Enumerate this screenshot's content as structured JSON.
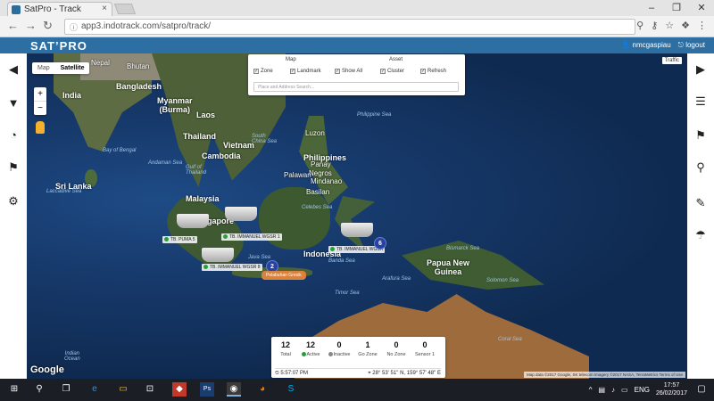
{
  "browser": {
    "tab_title": "SatPro - Track",
    "tab_close": "×",
    "url": "app3.indotrack.com/satpro/track/",
    "window_controls": [
      "–",
      "❐",
      "✕"
    ]
  },
  "app": {
    "logo": "SAT’PRO",
    "user": "nmcgaspiau",
    "logout": "logout"
  },
  "map": {
    "type_options": [
      "Map",
      "Satellite"
    ],
    "active_type": "Satellite",
    "traffic_label": "Traffic",
    "zoom_in": "+",
    "zoom_out": "−",
    "google": "Google",
    "attribution": "Map data ©2017 Google, SK telecom Imagery ©2017 NASA, TerraMetrics   Terms of Use",
    "labels": {
      "nepal": "Nepal",
      "bhutan": "Bhutan",
      "bangladesh": "Bangladesh",
      "india": "India",
      "myanmar": "Myanmar\n(Burma)",
      "laos": "Laos",
      "thailand": "Thailand",
      "vietnam": "Vietnam",
      "cambodia": "Cambodia",
      "philippines": "Philippines",
      "srilanka": "Sri Lanka",
      "malaysia": "Malaysia",
      "singapore": "Singapore",
      "indonesia": "Indonesia",
      "papua": "Papua New\nGuinea",
      "luzon": "Luzon",
      "panay": "Panay",
      "negros": "Negros",
      "mindanao": "Mindanao",
      "palawan": "Palawan",
      "basilan": "Basilan",
      "bay_bengal": "Bay of Bengal",
      "andaman": "Andaman Sea",
      "south_china": "South\nChina Sea",
      "gulf_thailand": "Gulf of\nThailand",
      "philippine_sea": "Philippine Sea",
      "celebes": "Celebes Sea",
      "laccadive": "Laccadive Sea",
      "java": "Java Sea",
      "banda": "Banda Sea",
      "arafura": "Arafura Sea",
      "timor": "Timor Sea",
      "coral": "Coral Sea",
      "solomon": "Solomon Sea",
      "bismarck": "Bismarck Sea",
      "indian_ocean": "Indian\nOcean"
    }
  },
  "filter": {
    "map_heading": "Map",
    "asset_heading": "Asset",
    "options": [
      {
        "label": "Zone",
        "checked": true
      },
      {
        "label": "Landmark",
        "checked": true
      },
      {
        "label": "Show All",
        "checked": true
      },
      {
        "label": "Cluster",
        "checked": true
      },
      {
        "label": "Refresh",
        "checked": true
      }
    ],
    "search_placeholder": "Place and Address Search..."
  },
  "vessels": [
    {
      "name": "TB. PUMA 5"
    },
    {
      "name": "TB. IMMANUEL WGSR 1"
    },
    {
      "name": "TB. IMMANUEL WGSR 8"
    },
    {
      "name": "TB. IMMANUEL WGSR"
    }
  ],
  "clusters": [
    "2",
    "6"
  ],
  "zone": "Pelabuhan Gresik",
  "status": {
    "stats": [
      {
        "value": "12",
        "label": "Total"
      },
      {
        "value": "12",
        "label": "Active",
        "color": "#2a9d3b"
      },
      {
        "value": "0",
        "label": "Inactive",
        "color": "#888888"
      },
      {
        "value": "1",
        "label": "Go Zone"
      },
      {
        "value": "0",
        "label": "No Zone"
      },
      {
        "value": "0",
        "label": "Sensor 1"
      }
    ],
    "time": "5:57:07 PM",
    "coords": "28° 53' 51'' N, 159° 57' 48'' E"
  },
  "taskbar": {
    "lang": "ENG",
    "time": "17:57",
    "date": "26/02/2017"
  }
}
